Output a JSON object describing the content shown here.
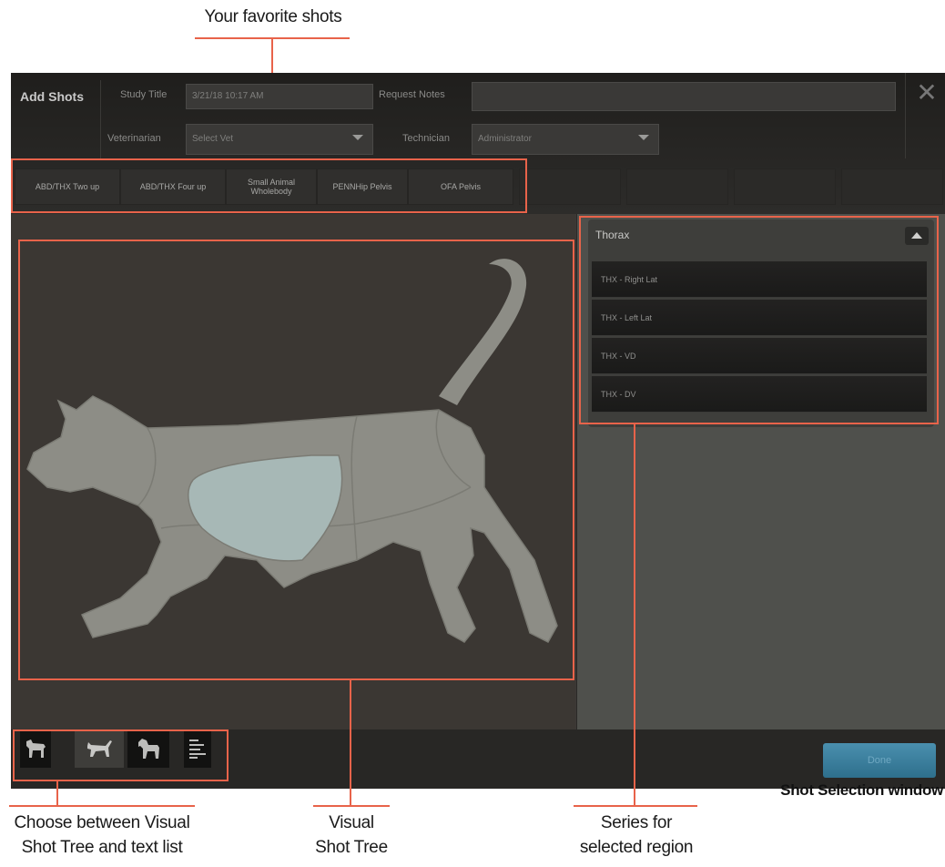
{
  "annotations": {
    "favorite_shots": "Your favorite shots",
    "choose_view": [
      "Choose between Visual",
      "Shot Tree and text list"
    ],
    "visual_tree": [
      "Visual",
      "Shot Tree"
    ],
    "series": [
      "Series for",
      "selected region"
    ],
    "window_caption": "Shot Selection window"
  },
  "header": {
    "title": "Add Shots",
    "study_title_label": "Study Title",
    "study_title_value": "3/21/18 10:17 AM",
    "request_notes_label": "Request Notes",
    "request_notes_value": "",
    "veterinarian_label": "Veterinarian",
    "veterinarian_value": "Select Vet",
    "technician_label": "Technician",
    "technician_value": "Administrator"
  },
  "favorites": [
    "ABD/THX Two up",
    "ABD/THX Four up",
    "Small Animal Wholebody",
    "PENNHip Pelvis",
    "OFA Pelvis",
    "",
    "",
    "",
    ""
  ],
  "series": {
    "region": "Thorax",
    "items": [
      "THX - Right Lat",
      "THX - Left Lat",
      "THX - VD",
      "THX - DV"
    ]
  },
  "footer": {
    "views": [
      "dog-icon",
      "cat-icon",
      "horse-icon",
      "list-icon"
    ],
    "active_view": "cat-icon",
    "done_label": "Done"
  },
  "colors": {
    "annotation": "#e8634a",
    "selected_region": "#a7b8b6",
    "body": "#8d8d86"
  }
}
